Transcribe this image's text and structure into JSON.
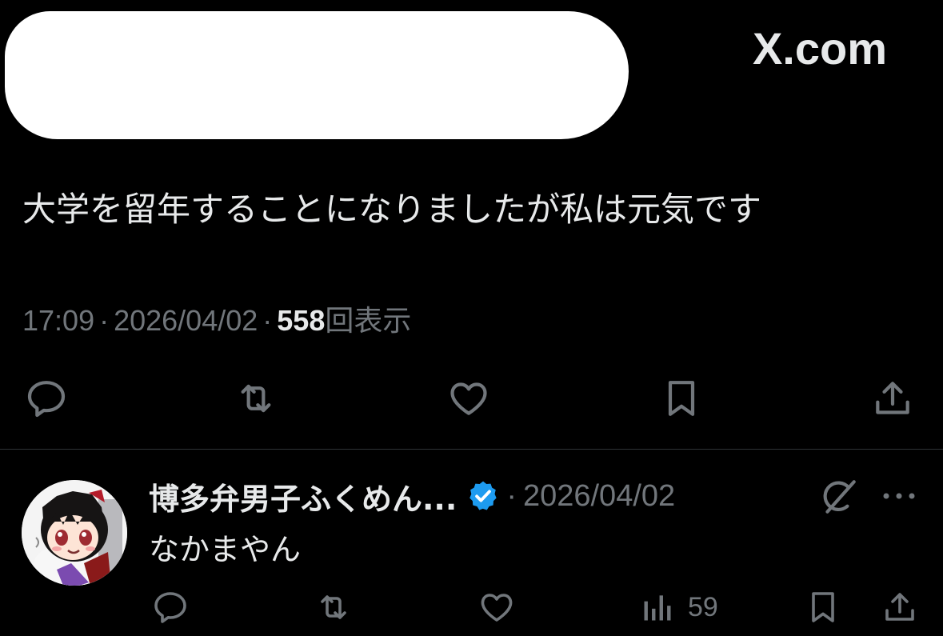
{
  "header": {
    "brand": "X.com"
  },
  "post": {
    "text": "大学を留年することになりましたが私は元気です",
    "time": "17:09",
    "date": "2026/04/02",
    "views_count": "558",
    "views_label": "回表示"
  },
  "reply": {
    "author_name": "博多弁男子ふくめん...",
    "date": "2026/04/02",
    "text": "なかまやん",
    "views": "59"
  },
  "colors": {
    "background": "#000000",
    "text": "#e7e9ea",
    "muted": "#71767b",
    "verified": "#1d9bf0"
  }
}
